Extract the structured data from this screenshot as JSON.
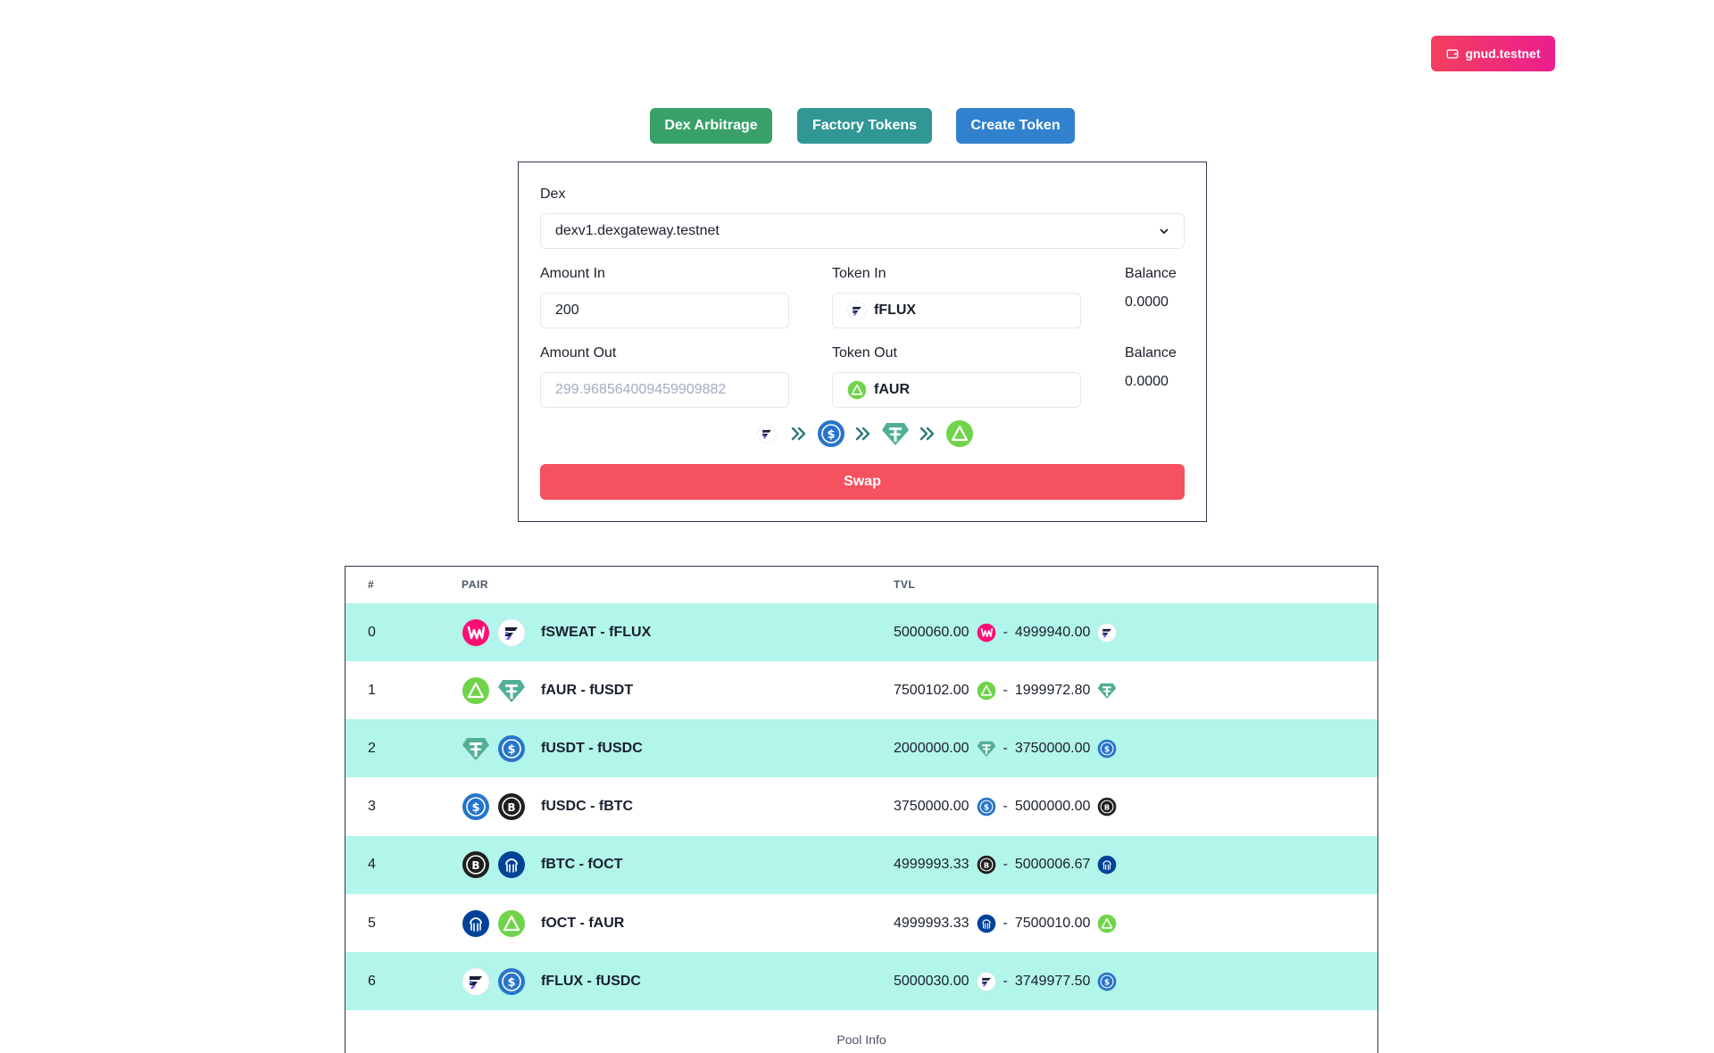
{
  "wallet": {
    "label": "gnud.testnet"
  },
  "nav": {
    "dex_arbitrage": "Dex Arbitrage",
    "factory_tokens": "Factory Tokens",
    "create_token": "Create Token"
  },
  "swap": {
    "dex_label": "Dex",
    "dex_value": "dexv1.dexgateway.testnet",
    "amount_in_label": "Amount In",
    "amount_in_value": "200",
    "token_in_label": "Token In",
    "token_in_value": "fFLUX",
    "token_in_icon": "flux-icon",
    "balance_in_label": "Balance",
    "balance_in_value": "0.0000",
    "amount_out_label": "Amount Out",
    "amount_out_placeholder": "299.968564009459909882",
    "token_out_label": "Token Out",
    "token_out_value": "fAUR",
    "token_out_icon": "aurora-icon",
    "balance_out_label": "Balance",
    "balance_out_value": "0.0000",
    "route": [
      "flux-icon",
      "usdc-icon",
      "usdt-icon",
      "aurora-icon"
    ],
    "swap_label": "Swap"
  },
  "pools": {
    "headers": {
      "index": "#",
      "pair": "PAIR",
      "tvl": "TVL"
    },
    "rows": [
      {
        "index": "0",
        "pair": "fSWEAT - fFLUX",
        "icons": [
          "sweat-icon",
          "flux-icon"
        ],
        "tvl_a": "5000060.00",
        "tvl_b": "4999940.00"
      },
      {
        "index": "1",
        "pair": "fAUR - fUSDT",
        "icons": [
          "aurora-icon",
          "usdt-icon"
        ],
        "tvl_a": "7500102.00",
        "tvl_b": "1999972.80"
      },
      {
        "index": "2",
        "pair": "fUSDT - fUSDC",
        "icons": [
          "usdt-icon",
          "usdc-icon"
        ],
        "tvl_a": "2000000.00",
        "tvl_b": "3750000.00"
      },
      {
        "index": "3",
        "pair": "fUSDC - fBTC",
        "icons": [
          "usdc-icon",
          "btc-icon"
        ],
        "tvl_a": "3750000.00",
        "tvl_b": "5000000.00"
      },
      {
        "index": "4",
        "pair": "fBTC - fOCT",
        "icons": [
          "btc-icon",
          "oct-icon"
        ],
        "tvl_a": "4999993.33",
        "tvl_b": "5000006.67"
      },
      {
        "index": "5",
        "pair": "fOCT - fAUR",
        "icons": [
          "oct-icon",
          "aurora-icon"
        ],
        "tvl_a": "4999993.33",
        "tvl_b": "7500010.00"
      },
      {
        "index": "6",
        "pair": "fFLUX - fUSDC",
        "icons": [
          "flux-icon",
          "usdc-icon"
        ],
        "tvl_a": "5000030.00",
        "tvl_b": "3749977.50"
      }
    ],
    "separator": "-",
    "caption": "Pool Info"
  }
}
